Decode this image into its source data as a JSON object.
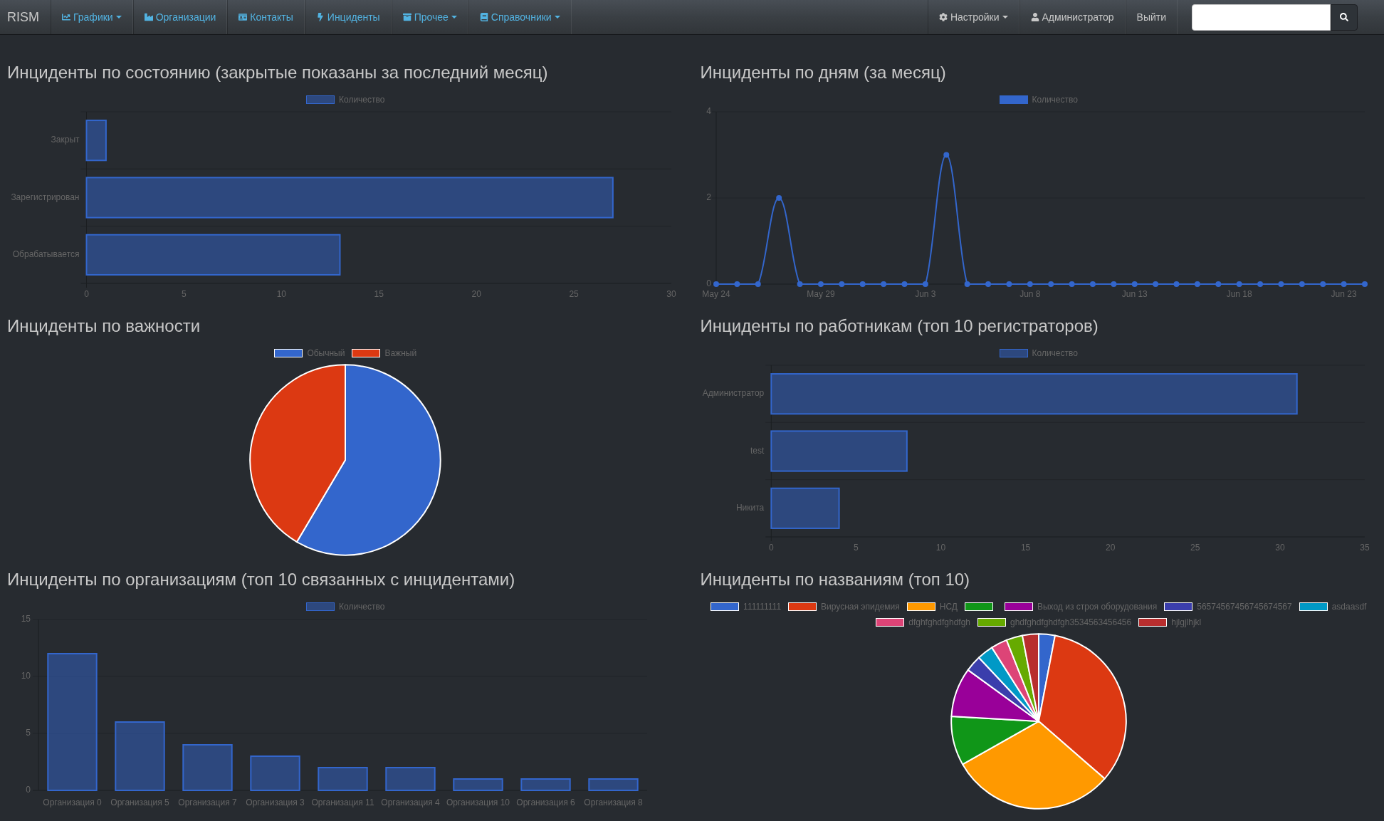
{
  "navbar": {
    "brand": "RISM",
    "left_items": [
      {
        "label": "Графики",
        "dropdown": true
      },
      {
        "label": "Организации",
        "dropdown": false
      },
      {
        "label": "Контакты",
        "dropdown": false
      },
      {
        "label": "Инциденты",
        "dropdown": false
      },
      {
        "label": "Прочее",
        "dropdown": true
      },
      {
        "label": "Справочники",
        "dropdown": true
      }
    ],
    "right_items": [
      {
        "label": "Настройки",
        "dropdown": true
      },
      {
        "label": "Администратор",
        "dropdown": false
      },
      {
        "label": "Выйти",
        "dropdown": false
      }
    ]
  },
  "panels": [
    {
      "title": "Инциденты по состоянию (закрытые показаны за последний месяц)",
      "chart_data": {
        "type": "bar",
        "orientation": "horizontal",
        "legend": "top",
        "categories": [
          "Закрыт",
          "Зарегистрирован",
          "Обрабатывается"
        ],
        "series": [
          {
            "name": "Количество",
            "color": "#3366cc",
            "values": [
              1,
              27,
              13
            ]
          }
        ],
        "xlim": [
          0,
          30
        ],
        "xticks": [
          0,
          5,
          10,
          15,
          20,
          25,
          30
        ]
      }
    },
    {
      "title": "Инциденты по дням (за месяц)",
      "chart_data": {
        "type": "line",
        "legend": "top",
        "categories": [
          "May 24",
          null,
          null,
          null,
          null,
          "May 29",
          null,
          null,
          null,
          null,
          "Jun 3",
          null,
          null,
          null,
          null,
          "Jun 8",
          null,
          null,
          null,
          null,
          "Jun 13",
          null,
          null,
          null,
          null,
          "Jun 18",
          null,
          null,
          null,
          null,
          "Jun 23",
          null
        ],
        "ylim": [
          0,
          4
        ],
        "yticks": [
          0,
          2,
          4
        ],
        "series": [
          {
            "name": "Количество",
            "color": "#3366cc",
            "marker": "circle",
            "values": [
              0,
              0,
              0,
              2,
              0,
              0,
              0,
              0,
              0,
              0,
              0,
              3,
              0,
              0,
              0,
              0,
              0,
              0,
              0,
              0,
              0,
              0,
              0,
              0,
              0,
              0,
              0,
              0,
              0,
              0,
              0,
              0
            ]
          }
        ]
      }
    },
    {
      "title": "Инциденты по важности",
      "chart_data": {
        "type": "pie",
        "legend": "top",
        "categories": [
          "Обычный",
          "Важный"
        ],
        "values": [
          58.5,
          41.5
        ],
        "colors": [
          "#3366cc",
          "#dc3912"
        ]
      }
    },
    {
      "title": "Инциденты по работникам (топ 10 регистраторов)",
      "chart_data": {
        "type": "bar",
        "orientation": "horizontal",
        "legend": "top",
        "categories": [
          "Администратор",
          "test",
          "Никита"
        ],
        "series": [
          {
            "name": "Количество",
            "color": "#3366cc",
            "values": [
              31,
              8,
              4
            ]
          }
        ],
        "xlim": [
          0,
          35
        ],
        "xticks": [
          0,
          5,
          10,
          15,
          20,
          25,
          30,
          35
        ]
      }
    },
    {
      "title": "Инциденты по организациям (топ 10 связанных с инцидентами)",
      "chart_data": {
        "type": "bar",
        "orientation": "vertical",
        "legend": "top",
        "categories": [
          "Организация 0",
          "Организация 5",
          "Организация 7",
          "Организация 3",
          "Организация 11",
          "Организация 4",
          "Организация 10",
          "Организация 6",
          "Организация 8"
        ],
        "series": [
          {
            "name": "Количество",
            "color": "#3366cc",
            "values": [
              12,
              6,
              4,
              3,
              2,
              2,
              1,
              1,
              1
            ]
          }
        ],
        "ylim": [
          0,
          15
        ],
        "yticks": [
          0,
          5,
          10,
          15
        ]
      }
    },
    {
      "title": "Инциденты по названиям (топ 10)",
      "chart_data": {
        "type": "pie",
        "legend": "top",
        "categories": [
          "111111111",
          "Вирусная эпидемия",
          "НСД",
          null,
          "Выход из строя оборудования",
          "56574567456745674567",
          "asdaasdf",
          "dfghfghdfghdfgh",
          "ghdfghdfghdfgh3534563456456",
          "hjlgjlhjkl"
        ],
        "values": [
          3.0,
          33.4,
          30.4,
          9.1,
          9.1,
          3.0,
          3.0,
          3.0,
          3.0,
          3.0
        ],
        "colors": [
          "#3366cc",
          "#dc3912",
          "#ff9900",
          "#109618",
          "#990099",
          "#3b3eac",
          "#0099c6",
          "#dd4477",
          "#66aa00",
          "#b82e2e"
        ]
      }
    }
  ]
}
